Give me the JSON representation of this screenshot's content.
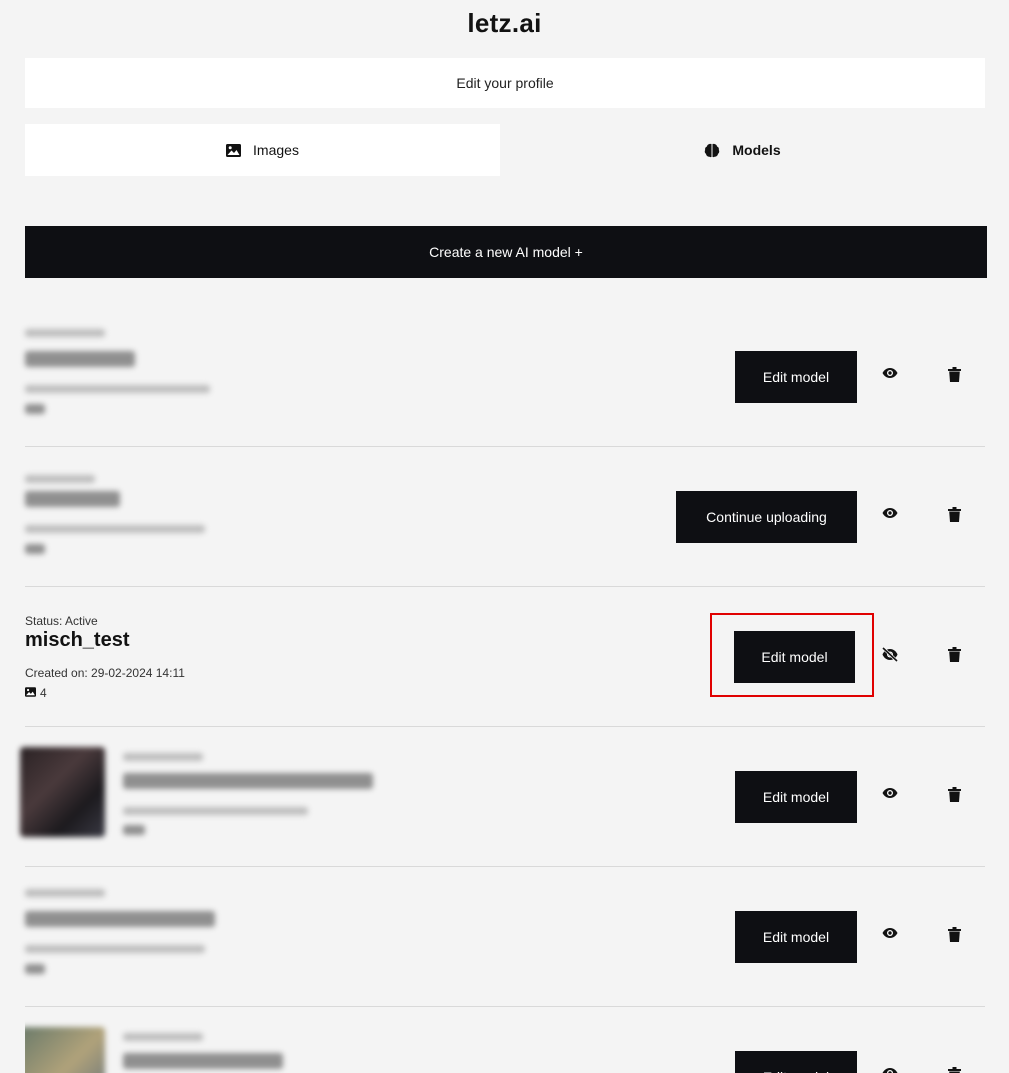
{
  "header": {
    "title": "letz.ai"
  },
  "profile": {
    "edit_label": "Edit your profile"
  },
  "tabs": [
    {
      "label": "Images",
      "icon": "image-icon"
    },
    {
      "label": "Models",
      "icon": "brain-icon"
    }
  ],
  "create_button": {
    "label": "Create a new AI model +"
  },
  "models": [
    {
      "blurred": true,
      "action_label": "Edit model",
      "visibility_icon": "eye-icon"
    },
    {
      "blurred": true,
      "action_label": "Continue uploading",
      "visibility_icon": "eye-icon"
    },
    {
      "blurred": false,
      "status": "Status: Active",
      "name": "misch_test",
      "created": "Created on: 29-02-2024 14:11",
      "image_count": "4",
      "action_label": "Edit model",
      "visibility_icon": "eye-slash-icon",
      "highlighted": true
    },
    {
      "blurred": true,
      "action_label": "Edit model",
      "visibility_icon": "eye-icon"
    },
    {
      "blurred": true,
      "action_label": "Edit model",
      "visibility_icon": "eye-icon"
    },
    {
      "blurred": true,
      "action_label": "Edit model",
      "visibility_icon": "eye-icon"
    }
  ],
  "colors": {
    "dark_button": "#0e0f13",
    "background": "#f4f4f4",
    "highlight": "#e00000"
  }
}
